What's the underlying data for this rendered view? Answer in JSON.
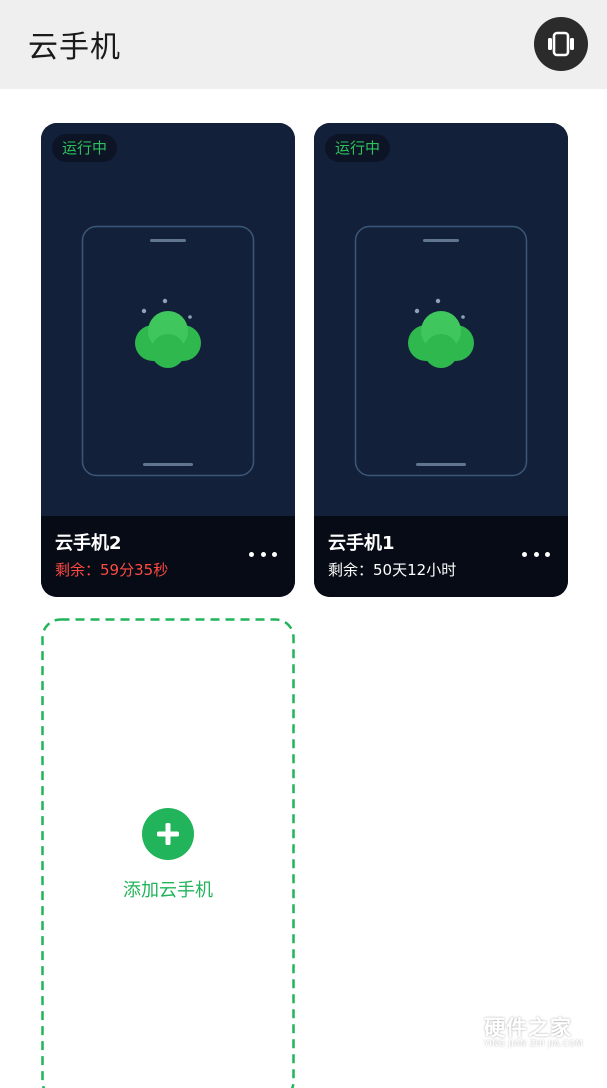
{
  "header": {
    "title": "云手机",
    "action_icon": "phone-switch-icon"
  },
  "phones": [
    {
      "status": "运行中",
      "name": "云手机2",
      "remain_prefix": "剩余：",
      "remain_value": "59分35秒",
      "remain_color": "#ff4a43"
    },
    {
      "status": "运行中",
      "name": "云手机1",
      "remain_prefix": "剩余：",
      "remain_value": "50天12小时",
      "remain_color": "#ffffff"
    }
  ],
  "add_card": {
    "label": "添加云手机",
    "icon": "plus-icon"
  },
  "watermark": {
    "title": "硬件之家",
    "subtitle": "YING JIAN ZHI JIA.COM"
  },
  "colors": {
    "accent": "#21b45a",
    "status_green": "#2ec15c",
    "card_bg": "#13203a",
    "card_footer": "#060b15",
    "warning_red": "#ff4a43"
  }
}
